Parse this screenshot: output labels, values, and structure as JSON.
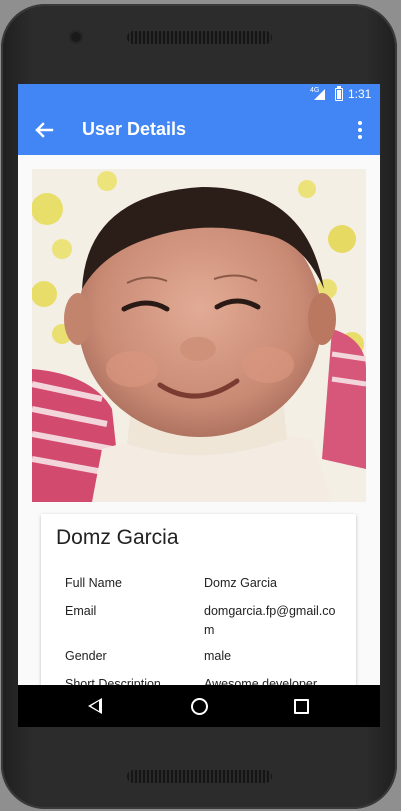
{
  "status_bar": {
    "network": "4G",
    "time": "1:31"
  },
  "app_bar": {
    "title": "User Details"
  },
  "profile": {
    "display_name": "Domz Garcia",
    "details": [
      {
        "label": "Full Name",
        "value": "Domz Garcia"
      },
      {
        "label": "Email",
        "value": "domgarcia.fp@gmail.com"
      },
      {
        "label": "Gender",
        "value": "male"
      },
      {
        "label": "Short Description",
        "value": "Awesome developer"
      }
    ]
  },
  "colors": {
    "primary": "#4285f4",
    "nav_bar": "#000000"
  },
  "icons": {
    "back": "arrow-back-icon",
    "menu": "more-vert-icon",
    "nav": [
      "nav-back-icon",
      "nav-home-icon",
      "nav-recent-icon"
    ]
  }
}
